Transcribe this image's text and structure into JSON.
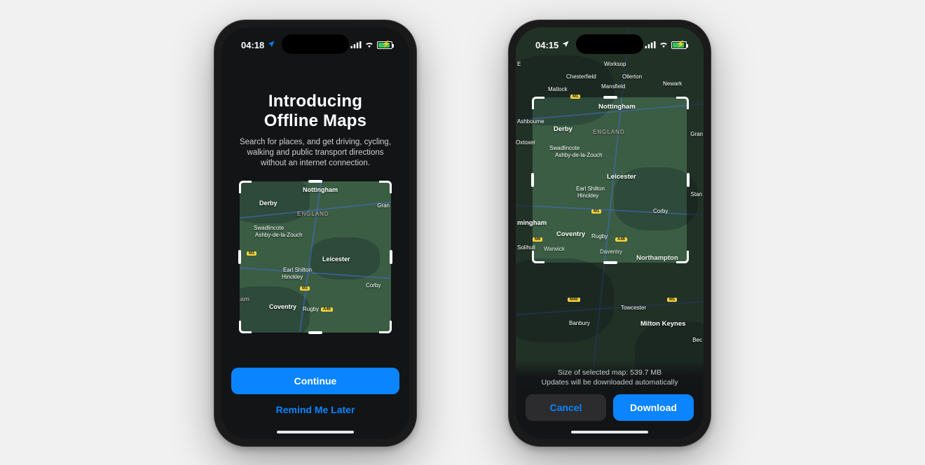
{
  "phone1": {
    "status": {
      "time": "04:18"
    },
    "intro": {
      "title_line1": "Introducing",
      "title_line2": "Offline Maps",
      "description": "Search for places, and get driving, cycling, walking and public transport directions without an internet connection."
    },
    "preview_map": {
      "region_label": "ENGLAND",
      "places": [
        "Derby",
        "Nottingham",
        "Swadlincote",
        "Ashby-de-la-Zouch",
        "Leicester",
        "Earl Shilton",
        "Hinckley",
        "Corby",
        "Coventry",
        "Rugby"
      ],
      "partial_places": [
        "gham",
        "Gran"
      ],
      "road_shields": [
        "M1",
        "M1",
        "A46"
      ]
    },
    "buttons": {
      "continue": "Continue",
      "remind_later": "Remind Me Later"
    }
  },
  "phone2": {
    "status": {
      "time": "04:15"
    },
    "map": {
      "region_label": "ENGLAND",
      "places_inside": [
        "Derby",
        "Nottingham",
        "Swadlincote",
        "Ashby-de-la-Zouch",
        "Leicester",
        "Earl Shilton",
        "Hinckley",
        "Corby",
        "Coventry",
        "Rugby",
        "Warwick",
        "Daventry",
        "Northampton"
      ],
      "places_outside": [
        "Worksop",
        "Chesterfield",
        "Ollerton",
        "Newark",
        "Matlock",
        "Mansfield",
        "Ashbourne",
        "Solihull",
        "Stan",
        "Oxtoxer",
        "Towcester",
        "Banbury",
        "Milton Keynes",
        "Bec",
        "E",
        "Gran"
      ],
      "partial_places": [
        "mingham"
      ],
      "road_shields": [
        "M1",
        "M1",
        "M6",
        "A46",
        "M40",
        "M1"
      ]
    },
    "footer": {
      "size_line": "Size of selected map: 539.7 MB",
      "updates_line": "Updates will be downloaded automatically"
    },
    "buttons": {
      "cancel": "Cancel",
      "download": "Download"
    }
  }
}
